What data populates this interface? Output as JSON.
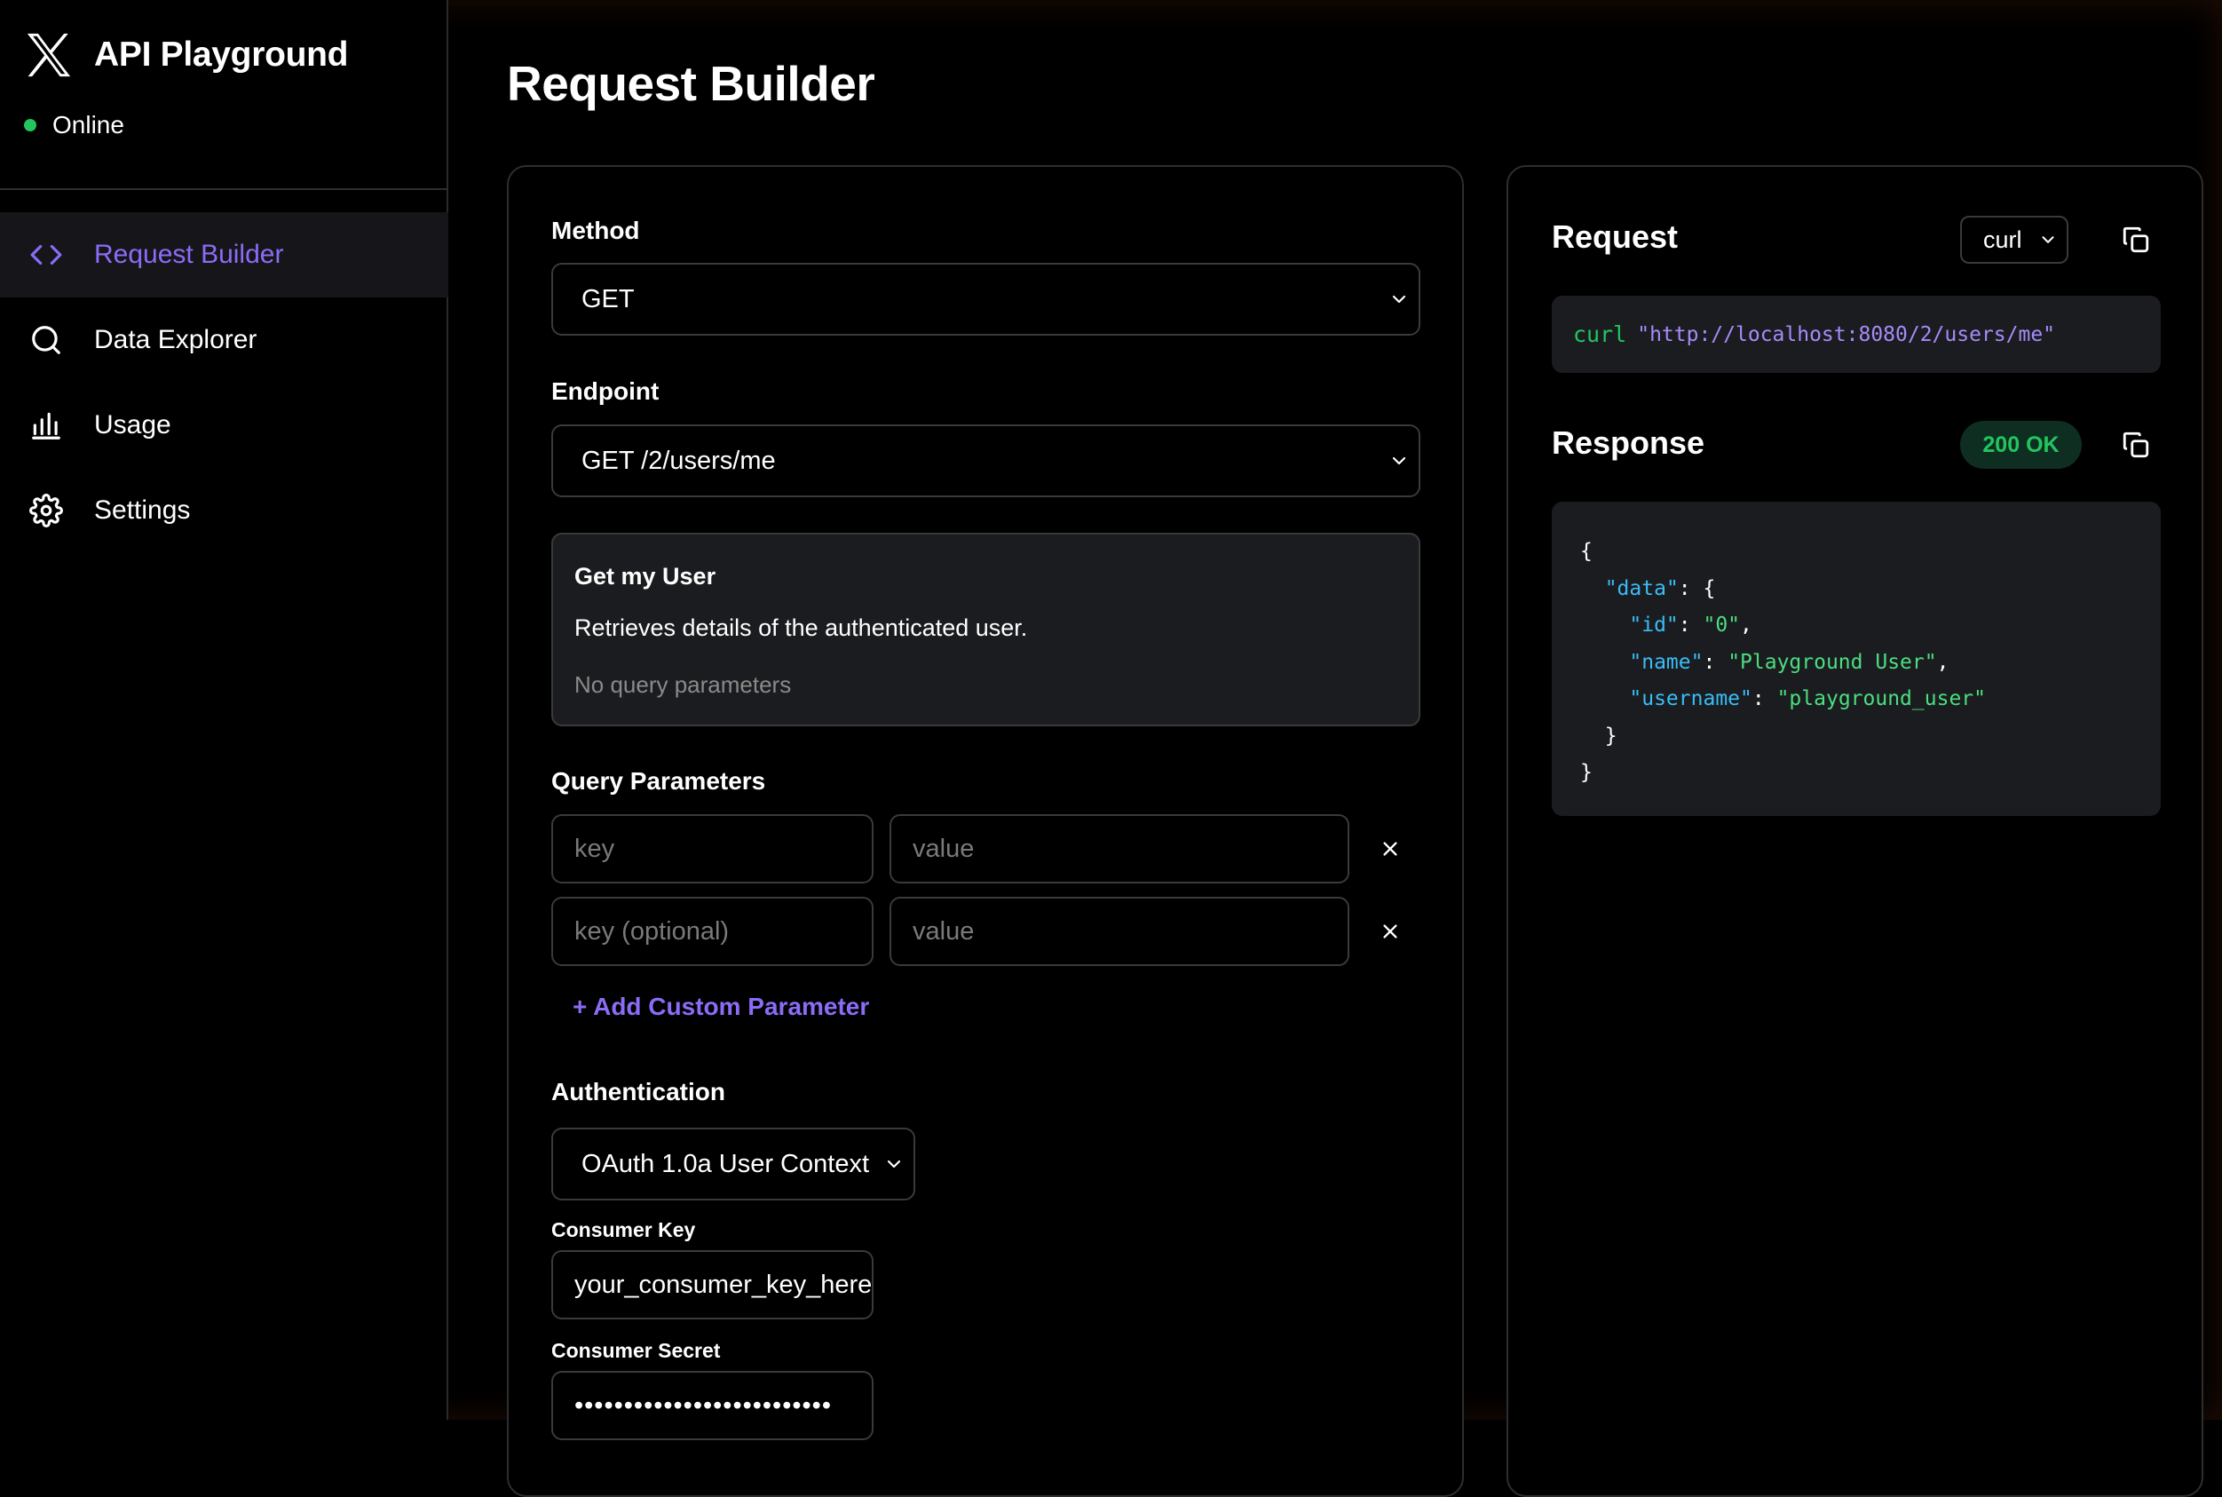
{
  "app": {
    "title": "API Playground",
    "status": "Online",
    "status_color": "#22c55e",
    "accent_color": "#8b6cf6"
  },
  "sidebar": {
    "items": [
      {
        "label": "Request Builder",
        "icon": "code-brackets-icon",
        "active": true
      },
      {
        "label": "Data Explorer",
        "icon": "search-icon",
        "active": false
      },
      {
        "label": "Usage",
        "icon": "bar-chart-icon",
        "active": false
      },
      {
        "label": "Settings",
        "icon": "gear-icon",
        "active": false
      }
    ]
  },
  "page": {
    "title": "Request Builder"
  },
  "builder": {
    "method_label": "Method",
    "method_value": "GET",
    "endpoint_label": "Endpoint",
    "endpoint_value": "GET /2/users/me",
    "info": {
      "title": "Get my User",
      "description": "Retrieves details of the authenticated user.",
      "note": "No query parameters"
    },
    "query_params_label": "Query Parameters",
    "params": [
      {
        "key_placeholder": "key",
        "value_placeholder": "value"
      },
      {
        "key_placeholder": "key (optional)",
        "value_placeholder": "value"
      }
    ],
    "add_param_label": "+ Add Custom Parameter",
    "auth_label": "Authentication",
    "auth_value": "OAuth 1.0a User Context",
    "consumer_key_label": "Consumer Key",
    "consumer_key_value": "your_consumer_key_here",
    "consumer_secret_label": "Consumer Secret",
    "consumer_secret_value": "••••••••••••••••••••••••••"
  },
  "request_panel": {
    "title": "Request",
    "format_value": "curl",
    "command": "curl",
    "url": "\"http://localhost:8080/2/users/me\""
  },
  "response_panel": {
    "title": "Response",
    "status_badge": "200 OK",
    "json": {
      "id": "\"0\"",
      "name": "\"Playground User\"",
      "username": "\"playground_user\""
    }
  }
}
